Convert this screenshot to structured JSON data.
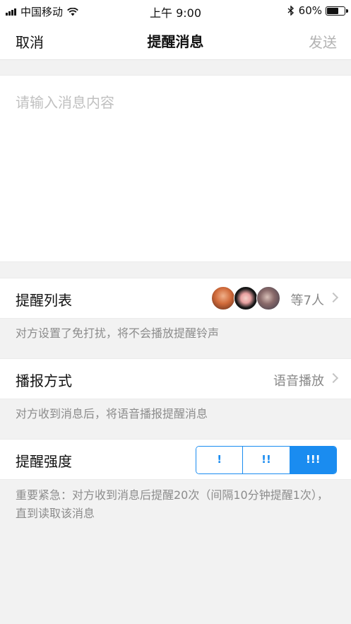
{
  "status_bar": {
    "carrier": "中国移动",
    "time": "上午 9:00",
    "battery": "60%"
  },
  "nav": {
    "cancel": "取消",
    "title": "提醒消息",
    "send": "发送"
  },
  "message": {
    "placeholder": "请输入消息内容"
  },
  "recipients": {
    "label": "提醒列表",
    "count_text": "等7人",
    "hint": "对方设置了免打扰，将不会播放提醒铃声"
  },
  "broadcast": {
    "label": "播报方式",
    "value": "语音播放",
    "hint": "对方收到消息后，将语音播报提醒消息"
  },
  "intensity": {
    "label": "提醒强度",
    "options": [
      "!",
      "!!",
      "!!!"
    ],
    "selected": "!!!",
    "hint": "重要紧急：对方收到消息后提醒20次（间隔10分钟提醒1次），直到读取该消息"
  },
  "colors": {
    "accent": "#1a8cf0",
    "background": "#f2f2f2"
  }
}
